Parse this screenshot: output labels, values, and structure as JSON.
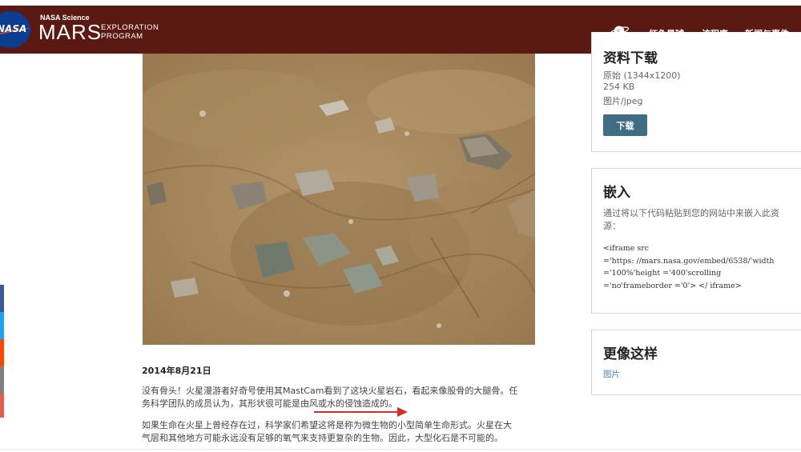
{
  "header": {
    "nasa_logo_text": "NASA",
    "brand_top": "NASA Science",
    "brand_main": "MARS",
    "brand_sub_line1": "EXPLORATION",
    "brand_sub_line2": "PROGRAM",
    "nav": [
      "红色星球",
      "该程序",
      "新闻与事件"
    ],
    "background_color": "#5a1913"
  },
  "article": {
    "date": "2014年8月21日",
    "para1_line1": "没有骨头！火星漫游者好奇号使用其MastCam看到了这块火星岩石，看起来像股骨的大腿骨。任",
    "para1_line2": "务科学团队的成员认为，其形状很可能是由风或水的侵蚀造成的。",
    "para2_line1": "如果生命在火星上曾经存在过，科学家们希望这将是称为微生物的小型简单生命形式。火星在大",
    "para2_line2": "气层和其他地方可能永远没有足够的氧气来支持更复杂的生物。因此，大型化石是不可能的。"
  },
  "download": {
    "title": "资料下载",
    "line1": "原始 (1344x1200)",
    "line2": "254 KB",
    "line3": "图片/jpeg",
    "button": "下载",
    "button_color": "#3f6d83"
  },
  "embed": {
    "title": "嵌入",
    "desc": "通过将以下代码粘贴到您的网站中来嵌入此资源：",
    "code_line1": "<iframe src",
    "code_line2": "='https: //mars.nasa.gov/embed/6538/'width",
    "code_line3": "='100%'height ='400'scrolling",
    "code_line4": "='no'frameborder ='0'> </ iframe>"
  },
  "more_like": {
    "title": "更像这样",
    "link": "图片"
  },
  "share_colors": [
    "#3b5998",
    "#1da1f2",
    "#ff4500",
    "#808080",
    "#e25d4e"
  ]
}
